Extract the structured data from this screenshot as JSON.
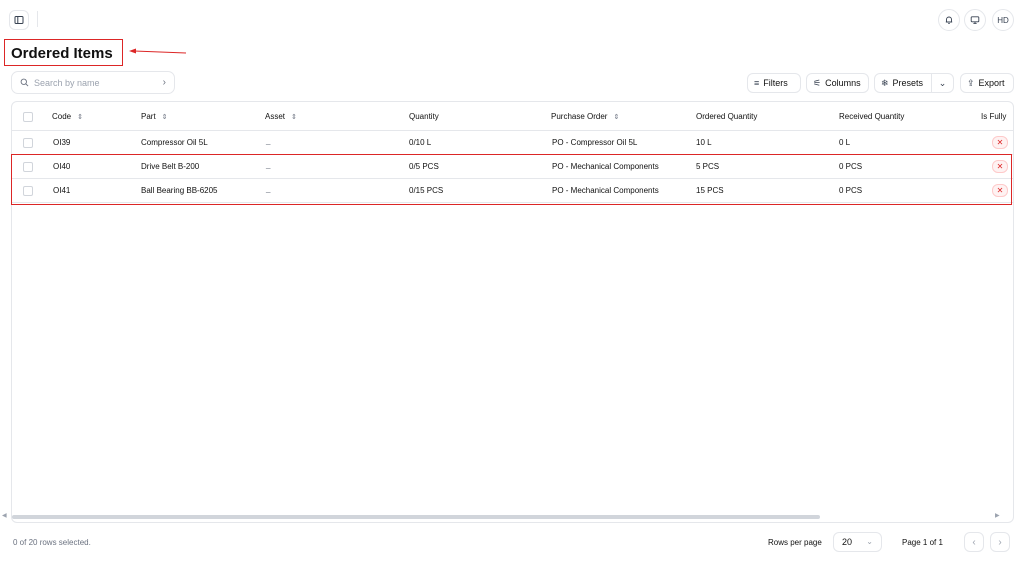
{
  "header": {
    "sidebar_toggle_icon": "sidebar-toggle-icon",
    "bell_icon": "bell-icon",
    "monitor_icon": "monitor-icon",
    "avatar_initials": "HD"
  },
  "page": {
    "title": "Ordered Items"
  },
  "toolbar": {
    "search_placeholder": "Search by name",
    "filters_label": "Filters",
    "columns_label": "Columns",
    "presets_label": "Presets",
    "export_label": "Export"
  },
  "table": {
    "columns": [
      "Code",
      "Part",
      "Asset",
      "Quantity",
      "Purchase Order",
      "Ordered Quantity",
      "Received Quantity",
      "Is Fully"
    ],
    "rows": [
      {
        "code": "OI39",
        "part": "Compressor Oil 5L",
        "asset": "_",
        "quantity": "0/10  L",
        "purchase_order": "PO - Compressor Oil 5L",
        "ordered_quantity": "10  L",
        "received_quantity": "0  L",
        "is_fully": "✕"
      },
      {
        "code": "OI40",
        "part": "Drive Belt B-200",
        "asset": "_",
        "quantity": "0/5  PCS",
        "purchase_order": "PO - Mechanical Components",
        "ordered_quantity": "5  PCS",
        "received_quantity": "0  PCS",
        "is_fully": "✕"
      },
      {
        "code": "OI41",
        "part": "Ball Bearing BB-6205",
        "asset": "_",
        "quantity": "0/15  PCS",
        "purchase_order": "PO - Mechanical Components",
        "ordered_quantity": "15  PCS",
        "received_quantity": "0  PCS",
        "is_fully": "✕"
      }
    ]
  },
  "footer": {
    "selection_text": "0 of 20 rows selected.",
    "rows_per_page_label": "Rows per page",
    "rows_per_page_value": "20",
    "page_label": "Page 1 of 1"
  },
  "colors": {
    "highlight": "#dc2626",
    "border": "#e5e7eb",
    "muted_text": "#6b7280"
  }
}
